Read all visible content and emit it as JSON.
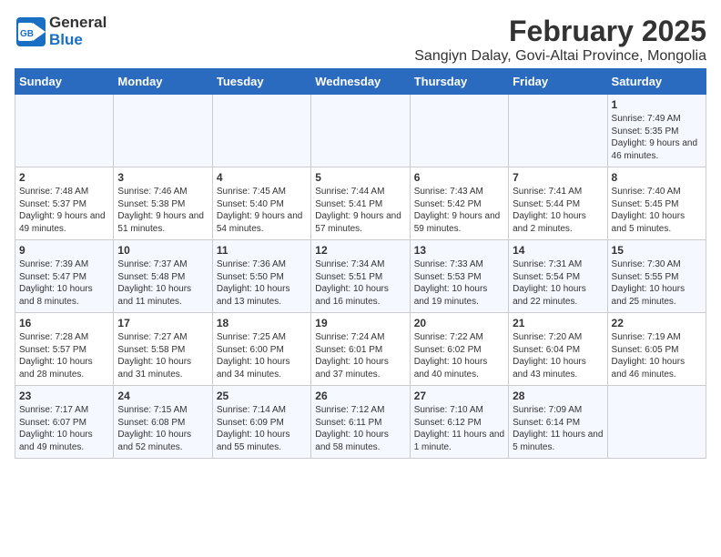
{
  "header": {
    "logo_general": "General",
    "logo_blue": "Blue",
    "month_title": "February 2025",
    "location": "Sangiyn Dalay, Govi-Altai Province, Mongolia"
  },
  "days_of_week": [
    "Sunday",
    "Monday",
    "Tuesday",
    "Wednesday",
    "Thursday",
    "Friday",
    "Saturday"
  ],
  "weeks": [
    [
      {
        "day": "",
        "info": ""
      },
      {
        "day": "",
        "info": ""
      },
      {
        "day": "",
        "info": ""
      },
      {
        "day": "",
        "info": ""
      },
      {
        "day": "",
        "info": ""
      },
      {
        "day": "",
        "info": ""
      },
      {
        "day": "1",
        "info": "Sunrise: 7:49 AM\nSunset: 5:35 PM\nDaylight: 9 hours and 46 minutes."
      }
    ],
    [
      {
        "day": "2",
        "info": "Sunrise: 7:48 AM\nSunset: 5:37 PM\nDaylight: 9 hours and 49 minutes."
      },
      {
        "day": "3",
        "info": "Sunrise: 7:46 AM\nSunset: 5:38 PM\nDaylight: 9 hours and 51 minutes."
      },
      {
        "day": "4",
        "info": "Sunrise: 7:45 AM\nSunset: 5:40 PM\nDaylight: 9 hours and 54 minutes."
      },
      {
        "day": "5",
        "info": "Sunrise: 7:44 AM\nSunset: 5:41 PM\nDaylight: 9 hours and 57 minutes."
      },
      {
        "day": "6",
        "info": "Sunrise: 7:43 AM\nSunset: 5:42 PM\nDaylight: 9 hours and 59 minutes."
      },
      {
        "day": "7",
        "info": "Sunrise: 7:41 AM\nSunset: 5:44 PM\nDaylight: 10 hours and 2 minutes."
      },
      {
        "day": "8",
        "info": "Sunrise: 7:40 AM\nSunset: 5:45 PM\nDaylight: 10 hours and 5 minutes."
      }
    ],
    [
      {
        "day": "9",
        "info": "Sunrise: 7:39 AM\nSunset: 5:47 PM\nDaylight: 10 hours and 8 minutes."
      },
      {
        "day": "10",
        "info": "Sunrise: 7:37 AM\nSunset: 5:48 PM\nDaylight: 10 hours and 11 minutes."
      },
      {
        "day": "11",
        "info": "Sunrise: 7:36 AM\nSunset: 5:50 PM\nDaylight: 10 hours and 13 minutes."
      },
      {
        "day": "12",
        "info": "Sunrise: 7:34 AM\nSunset: 5:51 PM\nDaylight: 10 hours and 16 minutes."
      },
      {
        "day": "13",
        "info": "Sunrise: 7:33 AM\nSunset: 5:53 PM\nDaylight: 10 hours and 19 minutes."
      },
      {
        "day": "14",
        "info": "Sunrise: 7:31 AM\nSunset: 5:54 PM\nDaylight: 10 hours and 22 minutes."
      },
      {
        "day": "15",
        "info": "Sunrise: 7:30 AM\nSunset: 5:55 PM\nDaylight: 10 hours and 25 minutes."
      }
    ],
    [
      {
        "day": "16",
        "info": "Sunrise: 7:28 AM\nSunset: 5:57 PM\nDaylight: 10 hours and 28 minutes."
      },
      {
        "day": "17",
        "info": "Sunrise: 7:27 AM\nSunset: 5:58 PM\nDaylight: 10 hours and 31 minutes."
      },
      {
        "day": "18",
        "info": "Sunrise: 7:25 AM\nSunset: 6:00 PM\nDaylight: 10 hours and 34 minutes."
      },
      {
        "day": "19",
        "info": "Sunrise: 7:24 AM\nSunset: 6:01 PM\nDaylight: 10 hours and 37 minutes."
      },
      {
        "day": "20",
        "info": "Sunrise: 7:22 AM\nSunset: 6:02 PM\nDaylight: 10 hours and 40 minutes."
      },
      {
        "day": "21",
        "info": "Sunrise: 7:20 AM\nSunset: 6:04 PM\nDaylight: 10 hours and 43 minutes."
      },
      {
        "day": "22",
        "info": "Sunrise: 7:19 AM\nSunset: 6:05 PM\nDaylight: 10 hours and 46 minutes."
      }
    ],
    [
      {
        "day": "23",
        "info": "Sunrise: 7:17 AM\nSunset: 6:07 PM\nDaylight: 10 hours and 49 minutes."
      },
      {
        "day": "24",
        "info": "Sunrise: 7:15 AM\nSunset: 6:08 PM\nDaylight: 10 hours and 52 minutes."
      },
      {
        "day": "25",
        "info": "Sunrise: 7:14 AM\nSunset: 6:09 PM\nDaylight: 10 hours and 55 minutes."
      },
      {
        "day": "26",
        "info": "Sunrise: 7:12 AM\nSunset: 6:11 PM\nDaylight: 10 hours and 58 minutes."
      },
      {
        "day": "27",
        "info": "Sunrise: 7:10 AM\nSunset: 6:12 PM\nDaylight: 11 hours and 1 minute."
      },
      {
        "day": "28",
        "info": "Sunrise: 7:09 AM\nSunset: 6:14 PM\nDaylight: 11 hours and 5 minutes."
      },
      {
        "day": "",
        "info": ""
      }
    ]
  ]
}
